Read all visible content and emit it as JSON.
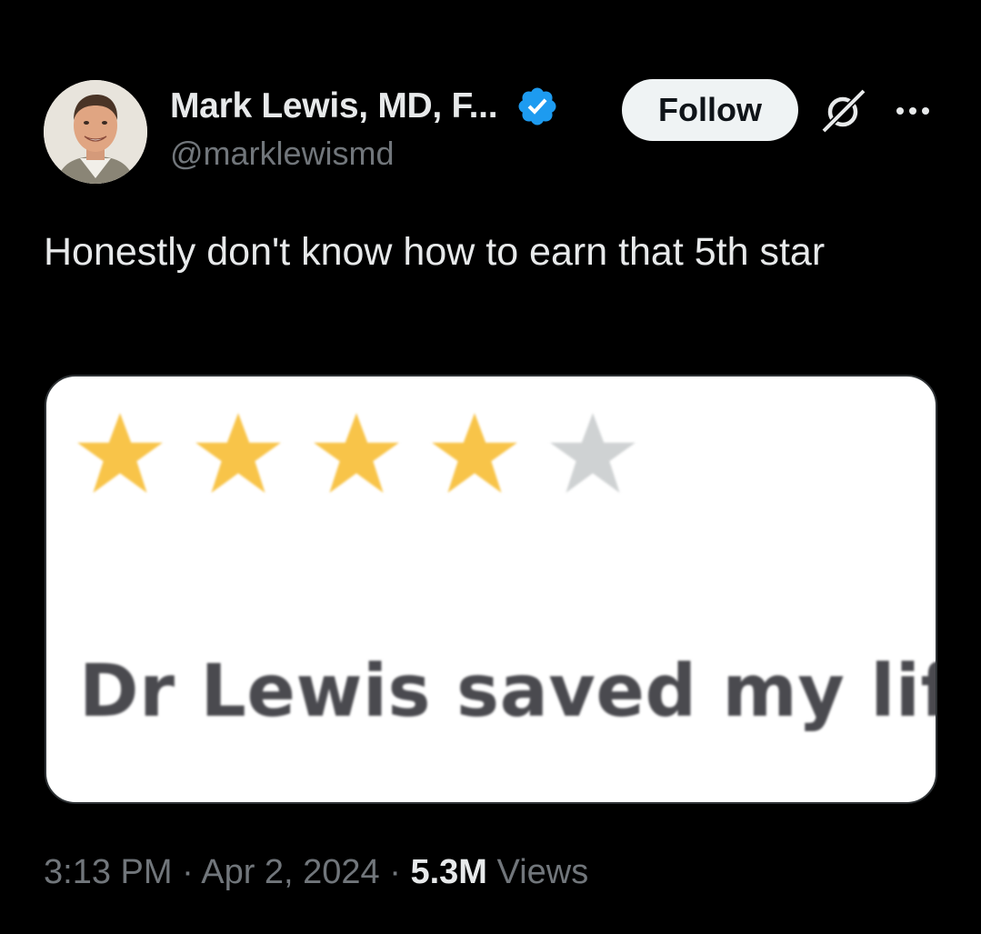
{
  "author": {
    "display_name": "Mark Lewis, MD, F...",
    "handle": "@marklewismd",
    "verified": true,
    "avatar_icon": "profile-photo"
  },
  "actions": {
    "follow_label": "Follow",
    "grok_icon": "grok-icon",
    "more_icon": "more-dots-icon"
  },
  "tweet": {
    "text": "Honestly don't know how to earn that 5th star"
  },
  "media": {
    "rating": 4,
    "rating_max": 5,
    "review_text": "Dr Lewis saved my life!",
    "star_filled_color": "#f8c449",
    "star_empty_color": "#cfd2d3"
  },
  "meta": {
    "time": "3:13 PM",
    "separator": "·",
    "date": "Apr 2, 2024",
    "views_count": "5.3M",
    "views_label": "Views"
  },
  "colors": {
    "background": "#000000",
    "verified_blue": "#1d9bf0",
    "primary_text": "#e7e9ea",
    "secondary_text": "#71767b"
  }
}
